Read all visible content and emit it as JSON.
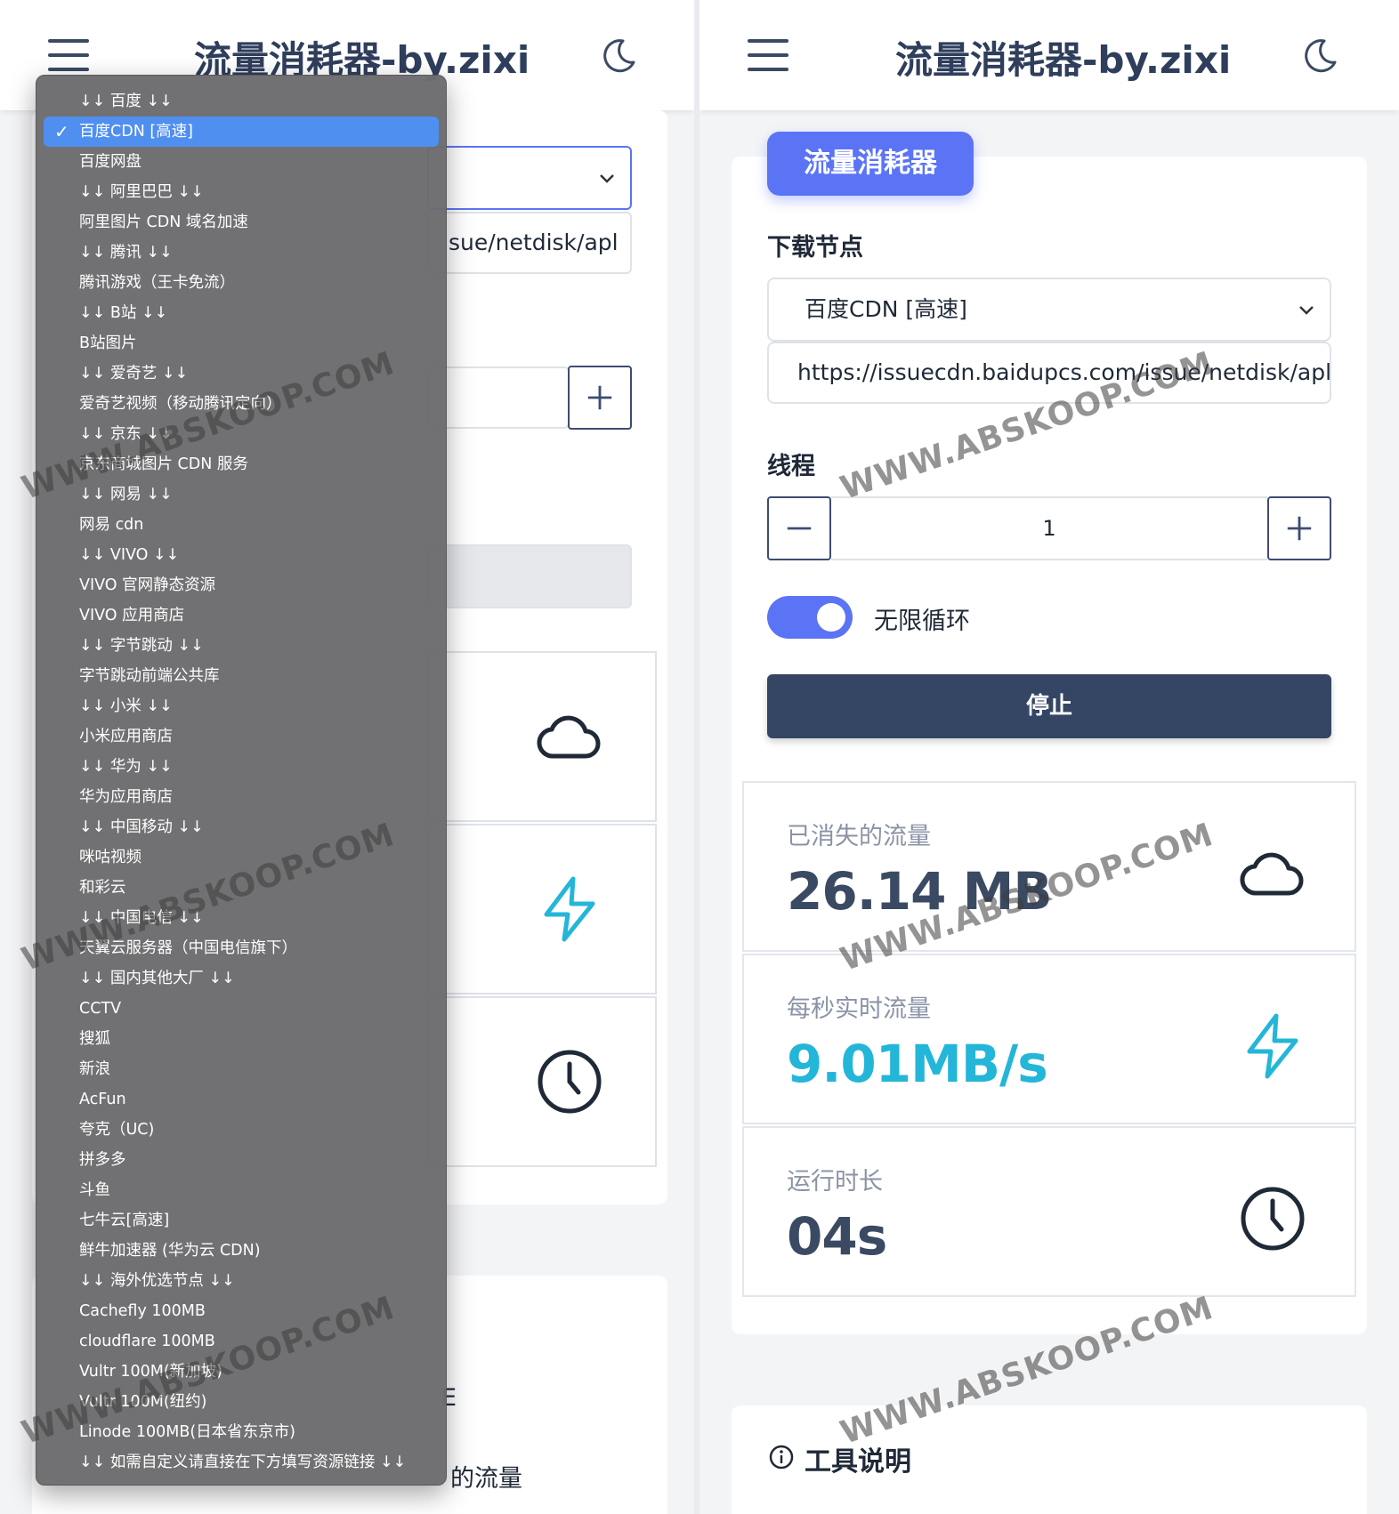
{
  "app": {
    "title": "流量消耗器-by.zixi"
  },
  "dropdown": {
    "options": [
      "↓↓ 百度 ↓↓",
      "百度CDN [高速]",
      "百度网盘",
      "↓↓ 阿里巴巴 ↓↓",
      "阿里图片 CDN 域名加速",
      "↓↓ 腾讯 ↓↓",
      "腾讯游戏（王卡免流）",
      "↓↓ B站 ↓↓",
      "B站图片",
      "↓↓ 爱奇艺 ↓↓",
      "爱奇艺视频（移动腾讯定向）",
      "↓↓ 京东 ↓↓",
      "京东商城图片 CDN 服务",
      "↓↓ 网易 ↓↓",
      "网易 cdn",
      "↓↓ VIVO ↓↓",
      "VIVO 官网静态资源",
      "VIVO 应用商店",
      "↓↓ 字节跳动 ↓↓",
      "字节跳动前端公共库",
      "↓↓ 小米 ↓↓",
      "小米应用商店",
      "↓↓ 华为 ↓↓",
      "华为应用商店",
      "↓↓ 中国移动 ↓↓",
      "咪咕视频",
      "和彩云",
      "↓↓ 中国电信 ↓↓",
      "天翼云服务器（中国电信旗下）",
      "↓↓ 国内其他大厂 ↓↓",
      "CCTV",
      "搜狐",
      "新浪",
      "AcFun",
      "夸克（UC)",
      "拼多多",
      "斗鱼",
      "七牛云[高速]",
      "鲜牛加速器 (华为云 CDN)",
      "↓↓ 海外优选节点 ↓↓",
      "Cachefly 100MB",
      "cloudflare 100MB",
      "Vultr 100M(新加坡)",
      "Vultr 100M(纽约)",
      "Linode 100MB(日本省东京市)",
      "↓↓ 如需自定义请直接在下方填写资源链接 ↓↓"
    ],
    "selected_index": 1,
    "check_mark": "✓"
  },
  "left_background": {
    "url_fragment": "sue/netdisk/apl",
    "footer_fragment_1": "E",
    "footer_fragment_2": "的流量"
  },
  "form": {
    "badge": "流量消耗器",
    "node_label": "下载节点",
    "node_selected": "百度CDN [高速]",
    "url_value": "https://issuecdn.baidupcs.com/issue/netdisk/apl",
    "thread_label": "线程",
    "thread_value": "1",
    "loop_label": "无限循环",
    "loop_on": true,
    "stop_label": "停止"
  },
  "stats": {
    "consumed_label": "已消失的流量",
    "consumed_value": "26.14 MB",
    "speed_label": "每秒实时流量",
    "speed_value": "9.01MB/s",
    "runtime_label": "运行时长",
    "runtime_value": "04s"
  },
  "info": {
    "title": "工具说明"
  },
  "watermark": "WWW.ABSKOOP.COM",
  "colors": {
    "accent": "#5b74f5",
    "dark_button": "#344663",
    "cyan": "#24b6d8",
    "title": "#2f3e5c"
  }
}
